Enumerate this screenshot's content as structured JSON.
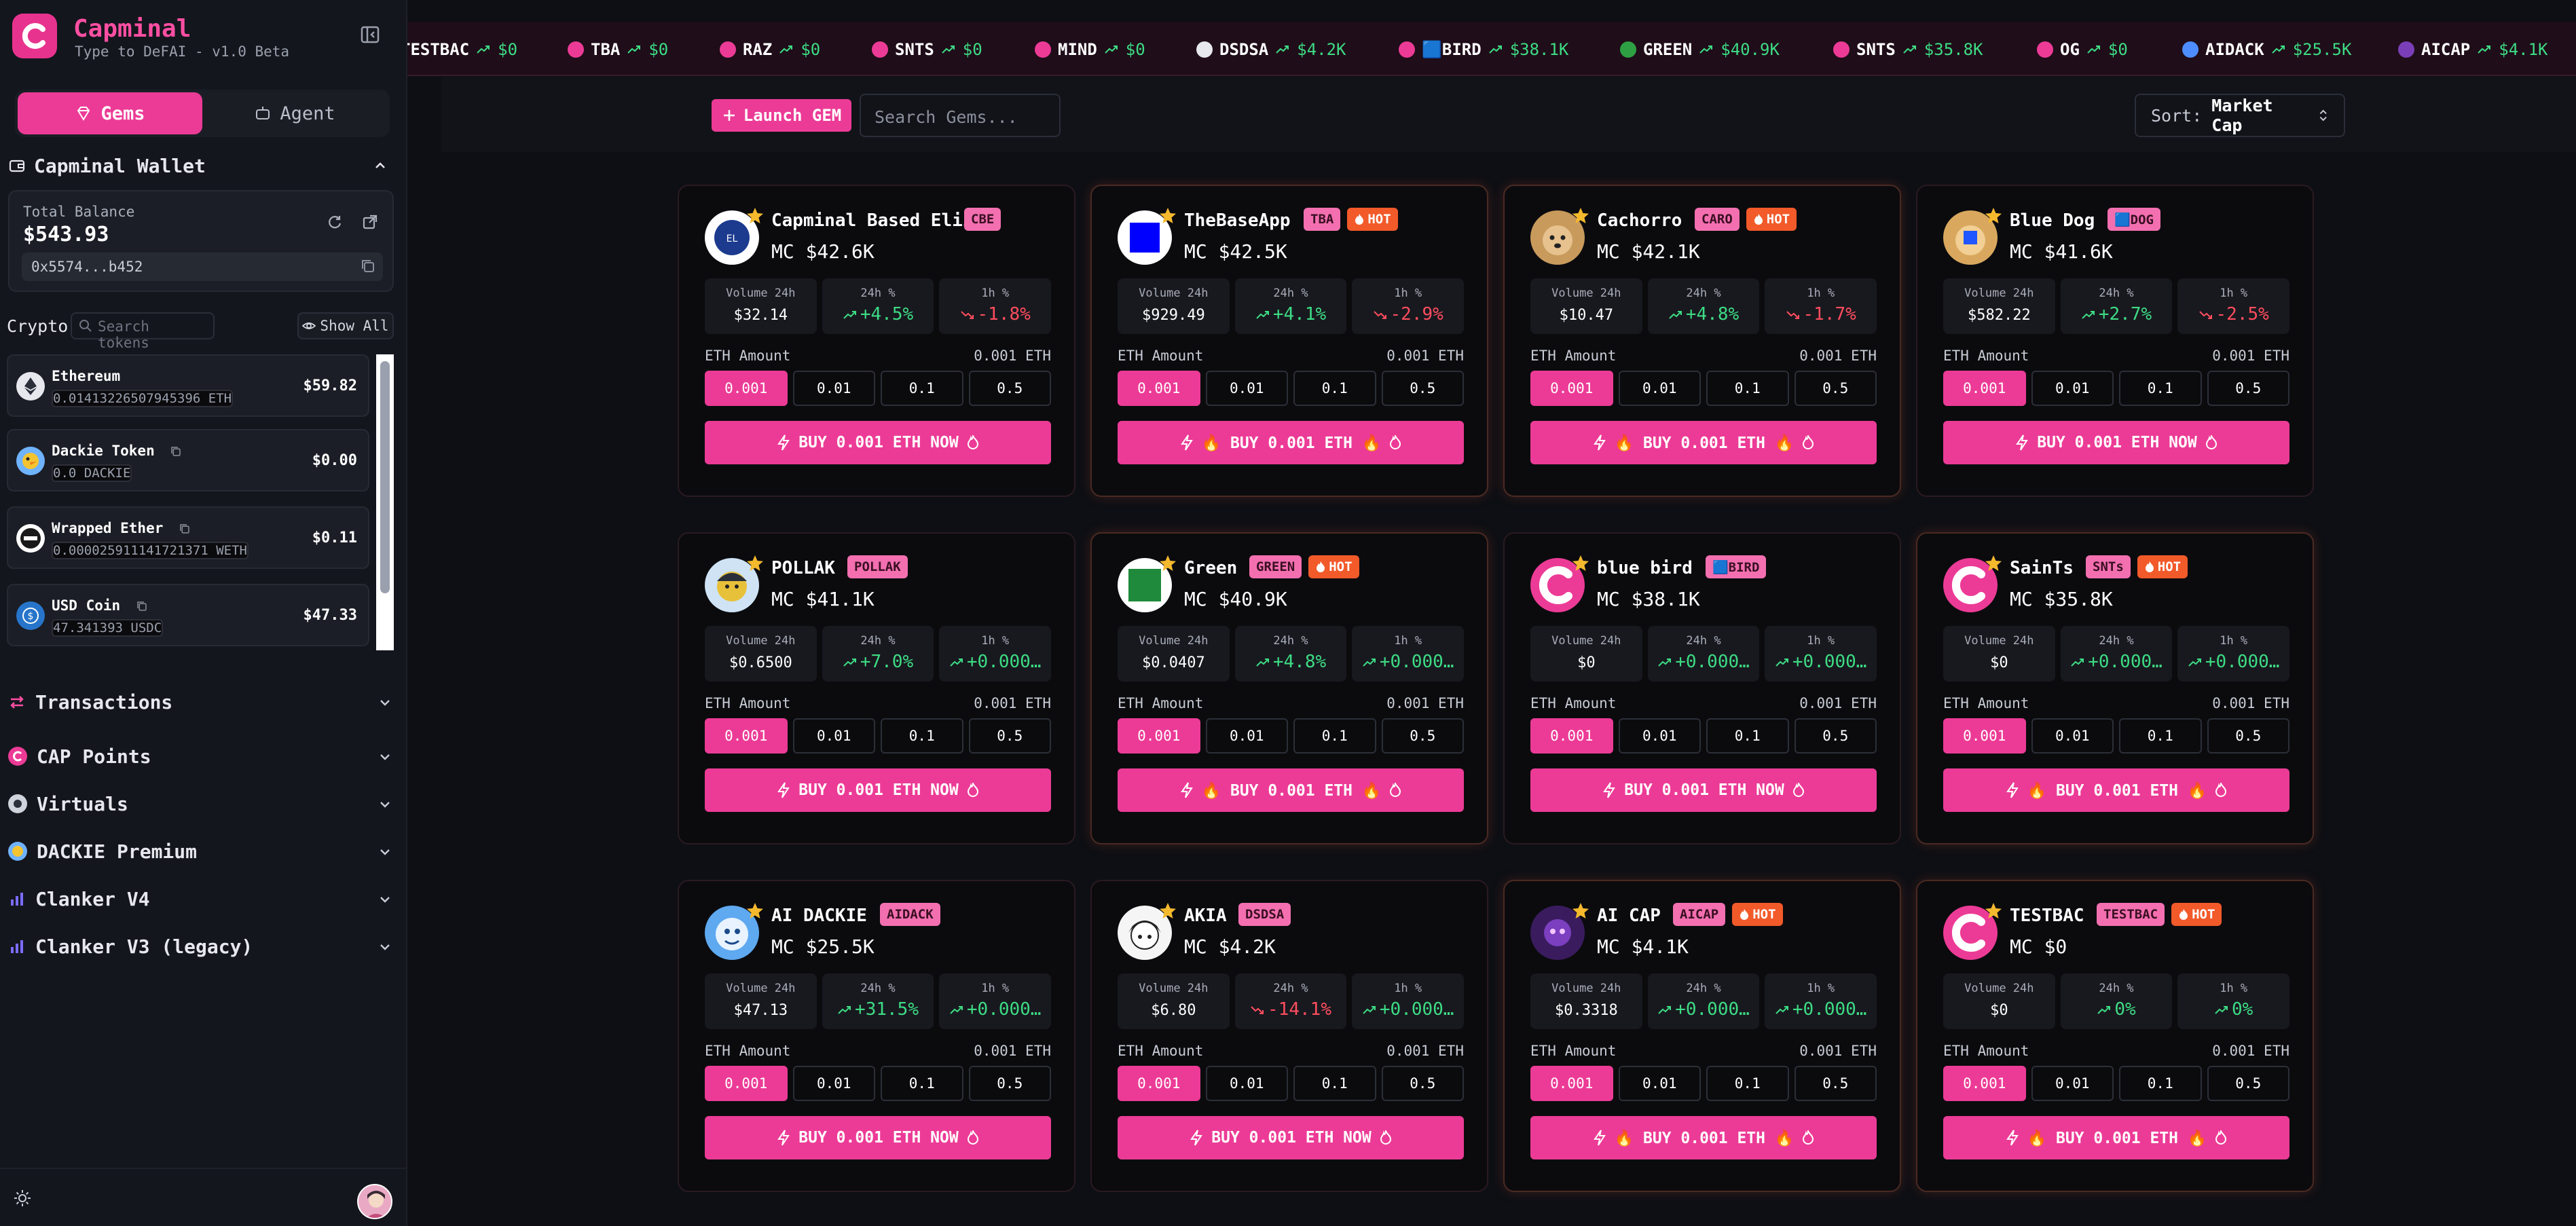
{
  "sidebar": {
    "title": "Capminal",
    "subtitle": "Type to DeFAI - v1.0 Beta",
    "toggle": {
      "gems": "Gems",
      "agent": "Agent"
    },
    "wallet": {
      "title": "Capminal Wallet",
      "balance_label": "Total Balance",
      "balance": "$543.93",
      "address": "0x5574...b452"
    },
    "crypto": {
      "label": "Crypto",
      "search_placeholder": "Search tokens",
      "show_all": "Show All",
      "tokens": [
        {
          "name": "Ethereum",
          "amount": "0.01413226507945396 ETH",
          "value": "$59.82",
          "icon": "ethereum-icon"
        },
        {
          "name": "Dackie Token",
          "amount": "0.0 DACKIE",
          "value": "$0.00",
          "icon": "dackie-icon"
        },
        {
          "name": "Wrapped Ether",
          "amount": "0.000025911141721371 WETH",
          "value": "$0.11",
          "icon": "weth-icon"
        },
        {
          "name": "USD Coin",
          "amount": "47.341393 USDC",
          "value": "$47.33",
          "icon": "usdc-icon"
        }
      ]
    },
    "sections": [
      {
        "label": "Transactions",
        "icon": "arrows-icon"
      },
      {
        "label": "CAP Points",
        "icon": "capminal-icon"
      },
      {
        "label": "Virtuals",
        "icon": "virtuals-icon"
      },
      {
        "label": "DACKIE Premium",
        "icon": "dackie-icon"
      },
      {
        "label": "Clanker V4",
        "icon": "bar-chart-icon"
      },
      {
        "label": "Clanker V3 (legacy)",
        "icon": "bar-chart-icon"
      }
    ]
  },
  "ticker": [
    {
      "sym": "TESTBAC",
      "val": "$0"
    },
    {
      "sym": "TBA",
      "val": "$0"
    },
    {
      "sym": "RAZ",
      "val": "$0"
    },
    {
      "sym": "SNTS",
      "val": "$0"
    },
    {
      "sym": "MIND",
      "val": "$0"
    },
    {
      "sym": "DSDSA",
      "val": "$4.2K"
    },
    {
      "sym": "🟦BIRD",
      "val": "$38.1K"
    },
    {
      "sym": "GREEN",
      "val": "$40.9K"
    },
    {
      "sym": "SNTS",
      "val": "$35.8K"
    },
    {
      "sym": "OG",
      "val": "$0"
    },
    {
      "sym": "AIDACK",
      "val": "$25.5K"
    },
    {
      "sym": "AICAP",
      "val": "$4.1K"
    }
  ],
  "toolbar": {
    "launch": "Launch GEM",
    "search_placeholder": "Search Gems...",
    "sort_label": "Sort:",
    "sort_value": "Market Cap"
  },
  "card_labels": {
    "volume": "Volume 24h",
    "change24": "24h %",
    "change1h": "1h %",
    "eth_amount": "ETH Amount",
    "eth_selected": "0.001 ETH",
    "amounts": [
      "0.001",
      "0.01",
      "0.1",
      "0.5"
    ],
    "hot": "HOT"
  },
  "cards": [
    {
      "name": "Capminal Based Eliza",
      "sym": "CBE",
      "hot": false,
      "mc": "MC $42.6K",
      "vol": "$32.14",
      "c24": "+4.5%",
      "c24_dir": "up",
      "c1h": "-1.8%",
      "c1h_dir": "down",
      "buy": "BUY 0.001 ETH NOW",
      "avatar": "eliza"
    },
    {
      "name": "TheBaseApp",
      "sym": "TBA",
      "hot": true,
      "mc": "MC $42.5K",
      "vol": "$929.49",
      "c24": "+4.1%",
      "c24_dir": "up",
      "c1h": "-2.9%",
      "c1h_dir": "down",
      "buy": "🔥 BUY 0.001 ETH 🔥",
      "avatar": "blue-square"
    },
    {
      "name": "Cachorro",
      "sym": "CARO",
      "hot": true,
      "mc": "MC $42.1K",
      "vol": "$10.47",
      "c24": "+4.8%",
      "c24_dir": "up",
      "c1h": "-1.7%",
      "c1h_dir": "down",
      "buy": "🔥 BUY 0.001 ETH 🔥",
      "avatar": "dog"
    },
    {
      "name": "Blue Dog",
      "sym": "🟦DOG",
      "hot": false,
      "mc": "MC $41.6K",
      "vol": "$582.22",
      "c24": "+2.7%",
      "c24_dir": "up",
      "c1h": "-2.5%",
      "c1h_dir": "down",
      "buy": "BUY 0.001 ETH NOW",
      "avatar": "dog2"
    },
    {
      "name": "POLLAK",
      "sym": "POLLAK",
      "hot": false,
      "mc": "MC $41.1K",
      "vol": "$0.6500",
      "c24": "+7.0%",
      "c24_dir": "up",
      "c1h": "+0.000…",
      "c1h_dir": "up",
      "buy": "BUY 0.001 ETH NOW",
      "avatar": "pollak"
    },
    {
      "name": "Green",
      "sym": "GREEN",
      "hot": true,
      "mc": "MC $40.9K",
      "vol": "$0.0407",
      "c24": "+4.8%",
      "c24_dir": "up",
      "c1h": "+0.000…",
      "c1h_dir": "up",
      "buy": "🔥 BUY 0.001 ETH 🔥",
      "avatar": "green-square"
    },
    {
      "name": "blue bird",
      "sym": "🟦BIRD",
      "hot": false,
      "mc": "MC $38.1K",
      "vol": "$0",
      "c24": "+0.000…",
      "c24_dir": "up",
      "c1h": "+0.000…",
      "c1h_dir": "up",
      "buy": "BUY 0.001 ETH NOW",
      "avatar": "capminal"
    },
    {
      "name": "SainTs",
      "sym": "SNTs",
      "hot": true,
      "mc": "MC $35.8K",
      "vol": "$0",
      "c24": "+0.000…",
      "c24_dir": "up",
      "c1h": "+0.000…",
      "c1h_dir": "up",
      "buy": "🔥 BUY 0.001 ETH 🔥",
      "avatar": "capminal"
    },
    {
      "name": "AI DACKIE",
      "sym": "AIDACK",
      "hot": false,
      "mc": "MC $25.5K",
      "vol": "$47.13",
      "c24": "+31.5%",
      "c24_dir": "up",
      "c1h": "+0.000…",
      "c1h_dir": "up",
      "buy": "BUY 0.001 ETH NOW",
      "avatar": "dackie"
    },
    {
      "name": "AKIA",
      "sym": "DSDSA",
      "hot": false,
      "mc": "MC $4.2K",
      "vol": "$6.80",
      "c24": "-14.1%",
      "c24_dir": "down",
      "c1h": "+0.000…",
      "c1h_dir": "up",
      "buy": "BUY 0.001 ETH NOW",
      "avatar": "akia"
    },
    {
      "name": "AI CAP",
      "sym": "AICAP",
      "hot": true,
      "mc": "MC $4.1K",
      "vol": "$0.3318",
      "c24": "+0.000…",
      "c24_dir": "up",
      "c1h": "+0.000…",
      "c1h_dir": "up",
      "buy": "🔥 BUY 0.001 ETH 🔥",
      "avatar": "aicap"
    },
    {
      "name": "TESTBAC",
      "sym": "TESTBAC",
      "hot": true,
      "mc": "MC $0",
      "vol": "$0",
      "c24": "0%",
      "c24_dir": "up",
      "c1h": "0%",
      "c1h_dir": "up",
      "buy": "🔥 BUY 0.001 ETH 🔥",
      "avatar": "capminal"
    }
  ],
  "colors": {
    "accent": "#ec3b96",
    "up": "#3ddc84",
    "down": "#ff4d5e",
    "hot": "#f25a2a"
  }
}
